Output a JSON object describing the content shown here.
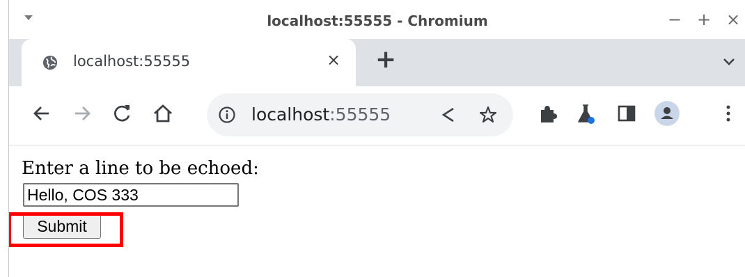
{
  "window": {
    "title": "localhost:55555 - Chromium",
    "minimize_label": "−",
    "maximize_label": "+",
    "close_label": "×"
  },
  "tab": {
    "title": "localhost:55555",
    "close_label": "×",
    "new_tab_label": "+"
  },
  "omnibox": {
    "host": "localhost",
    "port": ":55555"
  },
  "page": {
    "prompt": "Enter a line to be echoed:",
    "input_value": "Hello, COS 333",
    "submit_label": "Submit"
  },
  "colors": {
    "highlight": "#ff0000",
    "tabstrip": "#dee1e6",
    "omnibox": "#f1f3f4",
    "profile": "#c9d6ea",
    "beaker_dot": "#1a73e8"
  },
  "icons": [
    "window-menu-icon",
    "globe-icon",
    "tab-close-icon",
    "new-tab-icon",
    "tab-search-icon",
    "back-icon",
    "forward-icon",
    "reload-icon",
    "home-icon",
    "info-icon",
    "share-icon",
    "star-icon",
    "extensions-icon",
    "labs-icon",
    "side-panel-icon",
    "profile-icon",
    "menu-icon"
  ]
}
